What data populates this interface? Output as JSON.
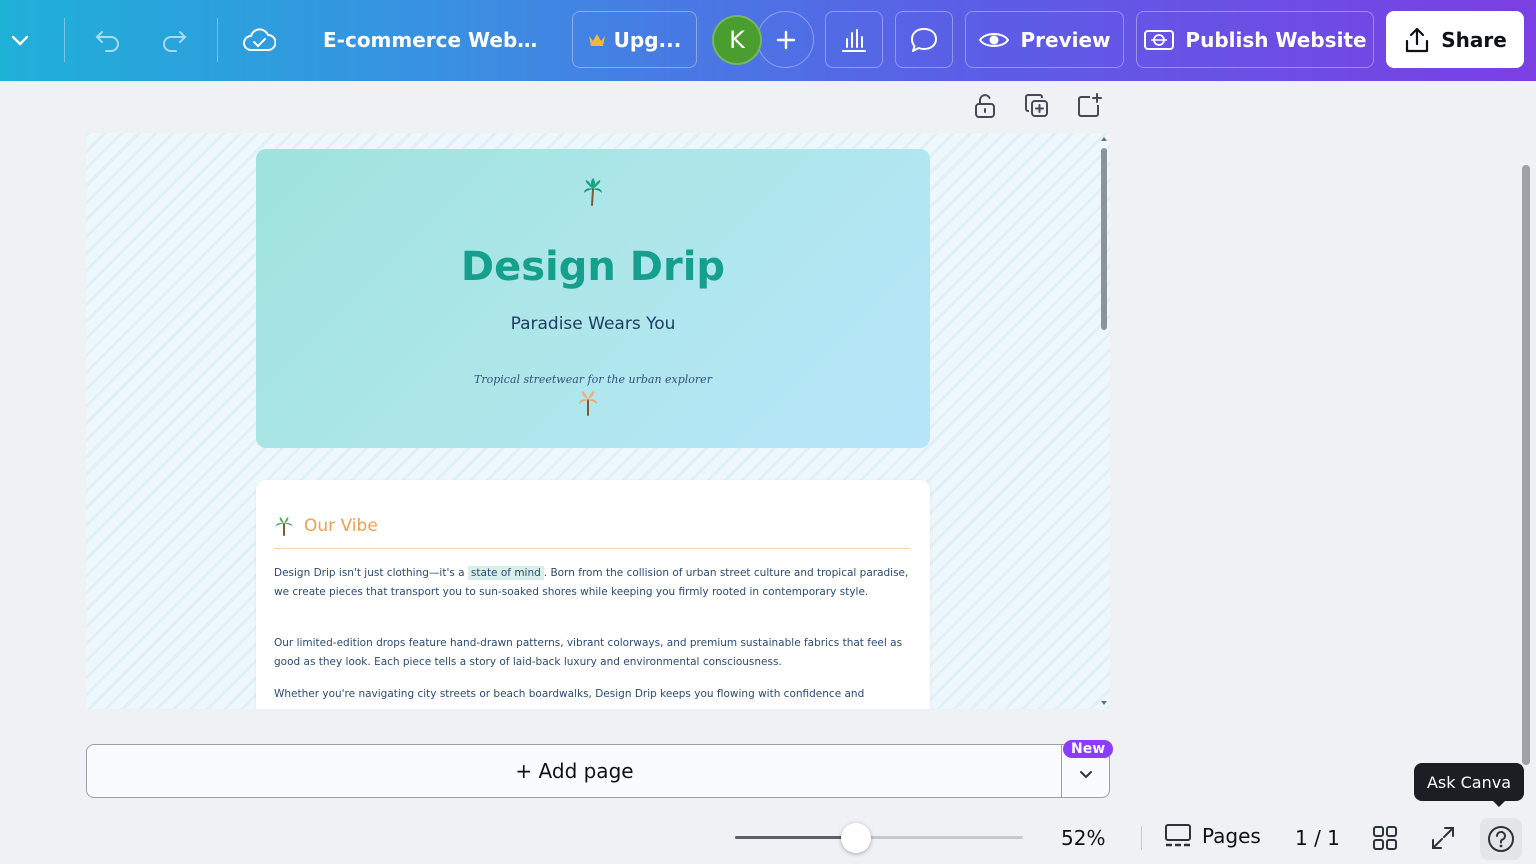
{
  "toolbar": {
    "doc_title": "E-commerce Websit...",
    "upgrade_label": "Upg...",
    "avatar_initial": "K",
    "preview_label": "Preview",
    "publish_label": "Publish Website",
    "share_label": "Share"
  },
  "design": {
    "hero_title": "Design Drip",
    "hero_subtitle": "Paradise Wears You",
    "hero_tagline": "Tropical streetwear for the urban explorer",
    "section_title": "Our Vibe",
    "para1_before": "Design Drip isn't just clothing—it's a ",
    "para1_highlight": "state of mind",
    "para1_after": ". Born from the collision of urban street culture and tropical paradise, we create pieces that transport you to sun-soaked shores while keeping you firmly rooted in contemporary style.",
    "para2": "Our limited-edition drops feature hand-drawn patterns, vibrant colorways, and premium sustainable fabrics that feel as good as they look. Each piece tells a story of laid-back luxury and environmental consciousness.",
    "para3": "Whether you're navigating city streets or beach boardwalks, Design Drip keeps you flowing with confidence and"
  },
  "addpage": {
    "label": "+ Add page",
    "badge": "New"
  },
  "bottombar": {
    "zoom": "52%",
    "zoom_fraction": 0.42,
    "pages_label": "Pages",
    "page_count": "1 / 1",
    "ask_canva": "Ask Canva"
  },
  "colors": {
    "hero_title": "#14a08c",
    "section_title": "#f0a04b",
    "brand_purple": "#8b3dff",
    "avatar": "#4a9d2f"
  }
}
